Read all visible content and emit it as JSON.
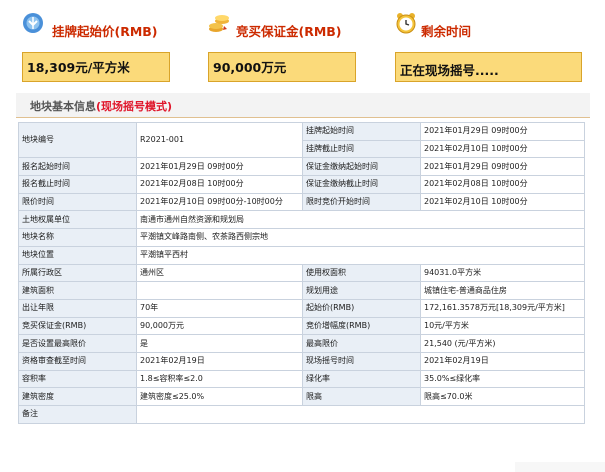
{
  "header": {
    "start_price_label": "挂牌起始价(RMB)",
    "deposit_label": "竞买保证金(RMB)",
    "time_left_label": "剩余时间"
  },
  "values": {
    "start_price": "18,309元/平方米",
    "deposit": "90,000万元",
    "time_left": "正在现场摇号....."
  },
  "section": {
    "title": "地块基本信息",
    "mode": "(现场摇号模式)"
  },
  "table": {
    "rows": [
      [
        "地块编号",
        "R2021-001",
        "挂牌起始时间",
        "2021年01月29日 09时00分"
      ],
      [
        "",
        "",
        "挂牌截止时间",
        "2021年02月10日 10时00分"
      ],
      [
        "报名起始时间",
        "2021年01月29日 09时00分",
        "保证金缴纳起始时间",
        "2021年01月29日 09时00分"
      ],
      [
        "报名截止时间",
        "2021年02月08日 10时00分",
        "保证金缴纳截止时间",
        "2021年02月08日 10时00分"
      ],
      [
        "限价时间",
        "2021年02月10日 09时00分-10时00分",
        "限时竞价开始时间",
        "2021年02月10日 10时00分"
      ],
      [
        "土地权属单位",
        "南通市通州自然资源和规划局",
        "",
        ""
      ],
      [
        "地块名称",
        "平潮镇文峰路南侧、农茶路西侧宗地",
        "",
        ""
      ],
      [
        "地块位置",
        "平潮镇平西村",
        "",
        ""
      ],
      [
        "所属行政区",
        "通州区",
        "使用权面积",
        "94031.0平方米"
      ],
      [
        "建筑面积",
        "",
        "规划用途",
        "城镇住宅-普通商品住房"
      ],
      [
        "出让年限",
        "70年",
        "起始价(RMB)",
        "172,161.3578万元[18,309元/平方米]"
      ],
      [
        "竞买保证金(RMB)",
        "90,000万元",
        "竞价增幅度(RMB)",
        "10元/平方米"
      ],
      [
        "是否设置最高限价",
        "是",
        "最高限价",
        "21,540 (元/平方米)"
      ],
      [
        "资格审查截至时间",
        "2021年02月19日",
        "现场摇号时间",
        "2021年02月19日"
      ],
      [
        "容积率",
        "1.8≤容积率≤2.0",
        "绿化率",
        "35.0%≤绿化率"
      ],
      [
        "建筑密度",
        "建筑密度≤25.0%",
        "限高",
        "限高≤70.0米"
      ],
      [
        "备注",
        "",
        "",
        ""
      ]
    ]
  }
}
